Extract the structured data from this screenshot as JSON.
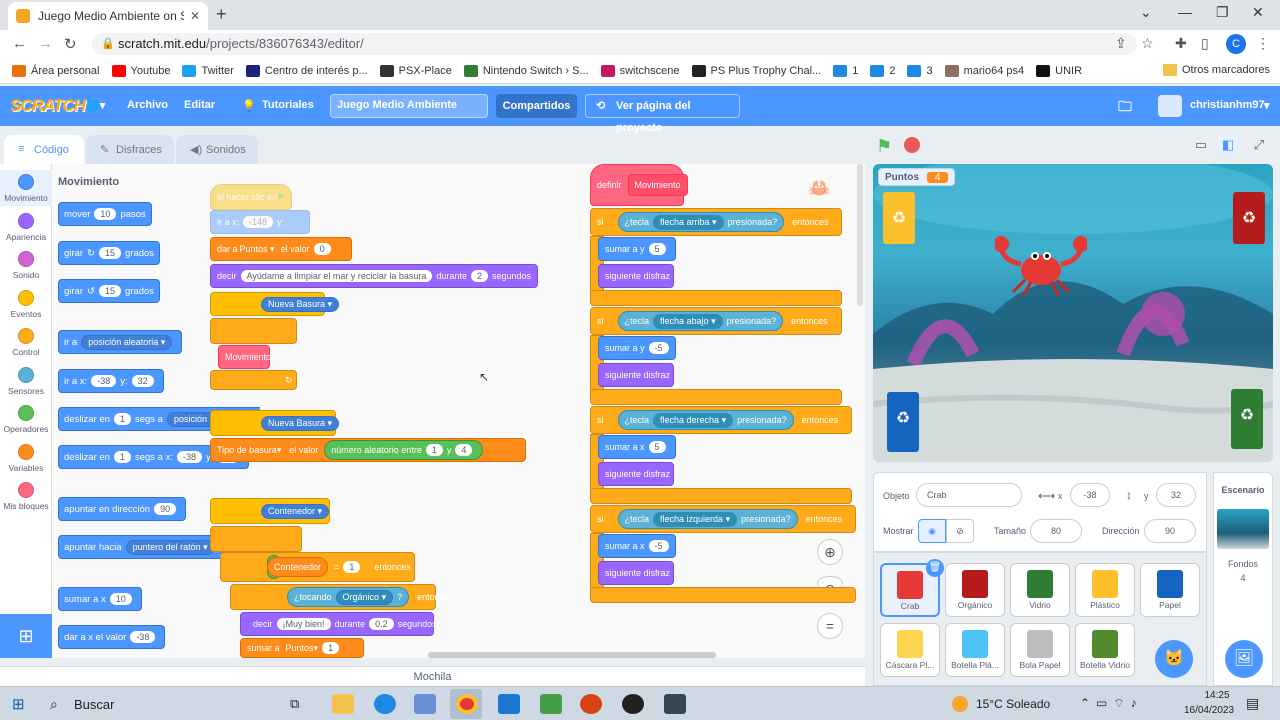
{
  "browser": {
    "tab_title": "Juego Medio Ambiente on Scrat",
    "url_host": "scratch.mit.edu",
    "url_path": "/projects/836076343/editor/",
    "profile_initial": "C",
    "bookmarks": [
      {
        "label": "Área personal",
        "color": "#e8710a"
      },
      {
        "label": "Youtube",
        "color": "#ff0000"
      },
      {
        "label": "Twitter",
        "color": "#1da1f2"
      },
      {
        "label": "Centro de interés p...",
        "color": "#1a237e"
      },
      {
        "label": "PSX-Place",
        "color": "#333333"
      },
      {
        "label": "Nintendo Switch › S...",
        "color": "#2e7d32"
      },
      {
        "label": "switchscene",
        "color": "#c2185b"
      },
      {
        "label": "PS Plus Trophy Chal...",
        "color": "#222222"
      },
      {
        "label": "1",
        "color": "#1e88e5"
      },
      {
        "label": "2",
        "color": "#1e88e5"
      },
      {
        "label": "3",
        "color": "#1e88e5"
      },
      {
        "label": "mario64 ps4",
        "color": "#8d6e63"
      },
      {
        "label": "UNIR",
        "color": "#111111"
      }
    ],
    "other_bookmarks": "Otros marcadores"
  },
  "menu": {
    "logo": "SCRATCH",
    "archivo": "Archivo",
    "editar": "Editar",
    "tutoriales": "Tutoriales",
    "project_title": "Juego Medio Ambiente",
    "compartidos": "Compartidos",
    "ver_pagina": "Ver página del proyecto",
    "username": "christianhm97"
  },
  "tabs": {
    "codigo": "Código",
    "disfraces": "Disfraces",
    "sonidos": "Sonidos"
  },
  "categories": [
    {
      "label": "Movimiento",
      "color": "#4c97ff"
    },
    {
      "label": "Apariencia",
      "color": "#9966ff"
    },
    {
      "label": "Sonido",
      "color": "#cf63cf"
    },
    {
      "label": "Eventos",
      "color": "#ffbf00"
    },
    {
      "label": "Control",
      "color": "#ffab19"
    },
    {
      "label": "Sensores",
      "color": "#5cb1d6"
    },
    {
      "label": "Operadores",
      "color": "#59c059"
    },
    {
      "label": "Variables",
      "color": "#ff8c1a"
    },
    {
      "label": "Mis bloques",
      "color": "#ff6680"
    }
  ],
  "palette": {
    "heading": "Movimiento",
    "mover": "mover",
    "mover_val": "10",
    "pasos": "pasos",
    "girar": "girar",
    "girar_r_val": "15",
    "girar_l_val": "15",
    "grados": "grados",
    "ir_a": "ir a",
    "posicion_aleatoria": "posición aleatoria",
    "ir_a_x": "ir a x:",
    "x_val": "-38",
    "y_lbl": "y:",
    "y_val": "32",
    "deslizar_en": "deslizar en",
    "seg_val": "1",
    "segs_a": "segs a",
    "segs_a_x": "segs a x:",
    "apuntar_dir": "apuntar en dirección",
    "dir_val": "90",
    "apuntar_hacia": "apuntar hacia",
    "puntero": "puntero del ratón",
    "sumar_x": "sumar a x",
    "sumar_x_val": "10",
    "dar_x": "dar a x el valor",
    "dar_x_val": "-38"
  },
  "script": {
    "left": {
      "al_hacer": "al hacer clic en",
      "ir_a_x": "ir a x:",
      "x": "-148",
      "y": "y:",
      "dar_a": "dar a",
      "var_puntos": "Puntos",
      "el_valor": "el valor",
      "zero": "0",
      "decir": "decir",
      "msg": "Ayúdame a limpiar el mar y reciclar la basura",
      "durante": "durante",
      "dos": "2",
      "segundos": "segundos",
      "nueva_basura_1": "Nueva Basura",
      "movimiento": "Movimiento",
      "nueva_basura_2": "Nueva Basura",
      "tipo_basura": "Tipo de basura",
      "aleatorio": "número aleatorio entre",
      "uno": "1",
      "y_word": "y",
      "cuatro": "4",
      "contenedor": "Contenedor",
      "contenedor_var": "Contenedor",
      "equals": "=",
      "one": "1",
      "entonces": "entonces",
      "tocando": "¿tocando",
      "organico": "Orgánico",
      "q": "?",
      "muy_bien": "¡Muy bien!",
      "dur2": "0.2",
      "sumar_a": "sumar a",
      "puntos2": "Puntos",
      "one2": "1"
    },
    "right": {
      "definir": "definir",
      "def_name": "Movimiento",
      "si": "si",
      "tecla": "¿tecla",
      "presionada": "presionada?",
      "entonces": "entonces",
      "rows": [
        {
          "key": "flecha arriba",
          "sumar": "sumar a y",
          "val": "5",
          "disfraz": "siguiente disfraz"
        },
        {
          "key": "flecha abajo",
          "sumar": "sumar a y",
          "val": "-5",
          "disfraz": "siguiente disfraz"
        },
        {
          "key": "flecha derecha",
          "sumar": "sumar a x",
          "val": "5",
          "disfraz": "siguiente disfraz"
        },
        {
          "key": "flecha izquierda",
          "sumar": "sumar a x",
          "val": "-5",
          "disfraz": "siguiente disfraz"
        }
      ]
    }
  },
  "mochila": "Mochila",
  "stage": {
    "monitor_label": "Puntos",
    "monitor_value": "4"
  },
  "sprite_info": {
    "objeto": "Objeto",
    "name": "Crab",
    "x_lbl": "x",
    "x": "-38",
    "y_lbl": "y",
    "y": "32",
    "mostrar": "Mostrar",
    "tamano": "Tamaño",
    "size": "80",
    "direccion": "Dirección",
    "direction": "90"
  },
  "sprites": [
    {
      "name": "Crab",
      "color": "#e53935"
    },
    {
      "name": "Orgánico",
      "color": "#b71c1c"
    },
    {
      "name": "Vidrio",
      "color": "#2e7d32"
    },
    {
      "name": "Plástico",
      "color": "#fbc02d"
    },
    {
      "name": "Papel",
      "color": "#1565c0"
    },
    {
      "name": "Cáscara Pl...",
      "color": "#ffd54f"
    },
    {
      "name": "Botella Plá...",
      "color": "#4fc3f7"
    },
    {
      "name": "Bola Papel",
      "color": "#bdbdbd"
    },
    {
      "name": "Botella Vidrio",
      "color": "#558b2f"
    }
  ],
  "stage_pane": {
    "escenario": "Escenario",
    "fondos": "Fondos",
    "fondos_count": "4"
  },
  "taskbar": {
    "search": "Buscar",
    "weather": "15°C  Soleado",
    "time": "14:25",
    "date": "16/04/2023"
  }
}
